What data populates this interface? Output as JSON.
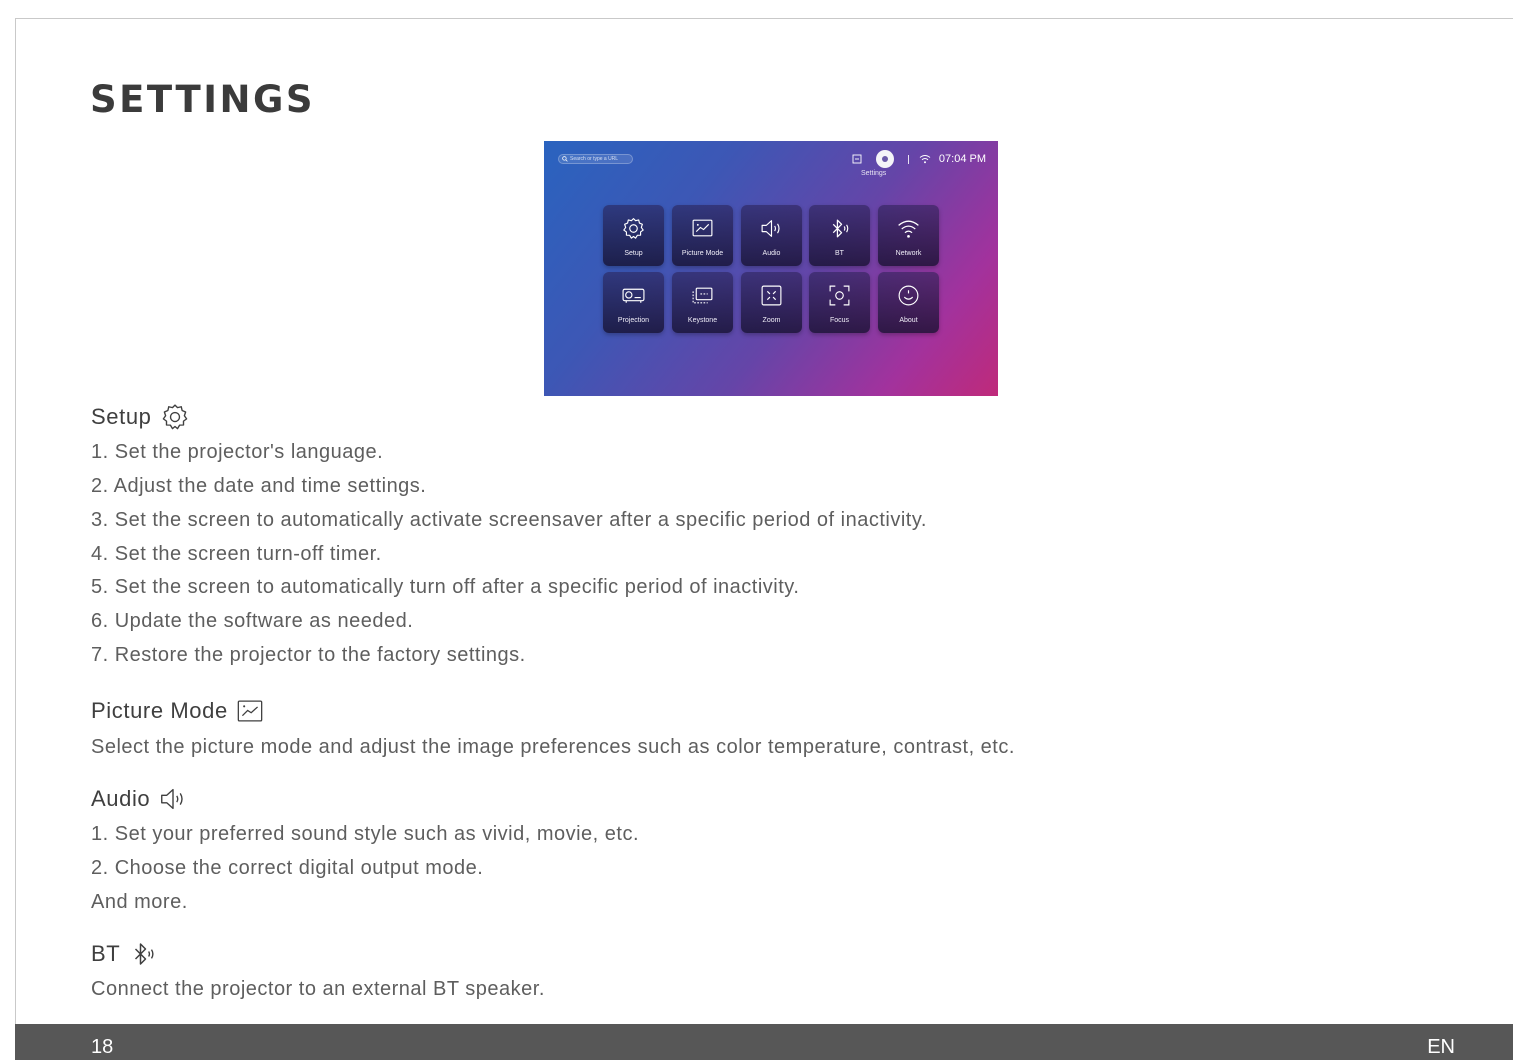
{
  "title": "SETTINGS",
  "screenshot": {
    "search_placeholder": "Search or type a URL",
    "time": "07:04 PM",
    "settings_label": "Settings",
    "tiles": [
      {
        "label": "Setup",
        "icon": "gear-icon"
      },
      {
        "label": "Picture Mode",
        "icon": "picture-mode-icon"
      },
      {
        "label": "Audio",
        "icon": "speaker-icon"
      },
      {
        "label": "BT",
        "icon": "bluetooth-audio-icon"
      },
      {
        "label": "Network",
        "icon": "wifi-icon"
      },
      {
        "label": "Projection",
        "icon": "projector-icon"
      },
      {
        "label": "Keystone",
        "icon": "keystone-icon"
      },
      {
        "label": "Zoom",
        "icon": "zoom-icon"
      },
      {
        "label": "Focus",
        "icon": "focus-icon"
      },
      {
        "label": "About",
        "icon": "smile-icon"
      }
    ]
  },
  "sections": {
    "setup": {
      "heading": "Setup",
      "lines": [
        "1. Set the projector's language.",
        "2. Adjust the date and time settings.",
        "3. Set the screen to automatically activate screensaver after a specific period of inactivity.",
        "4. Set the screen turn-off timer.",
        "5. Set the screen to automatically turn off after a specific period of inactivity.",
        "6. Update the software as needed.",
        "7. Restore the projector to the factory settings."
      ]
    },
    "picture_mode": {
      "heading": "Picture Mode",
      "lines": [
        "Select the picture mode and adjust the image preferences such as color temperature, contrast, etc."
      ]
    },
    "audio": {
      "heading": "Audio",
      "lines": [
        "1. Set your preferred sound style such as vivid, movie, etc.",
        "2. Choose the correct digital output mode.",
        "And more."
      ]
    },
    "bt": {
      "heading": "BT",
      "lines": [
        "Connect the projector to an external BT speaker."
      ]
    }
  },
  "footer": {
    "page_number": "18",
    "language": "EN"
  },
  "colors": {
    "footer_bg": "#575757",
    "title": "#3b3b3b",
    "body_text": "#5e5e5e"
  }
}
